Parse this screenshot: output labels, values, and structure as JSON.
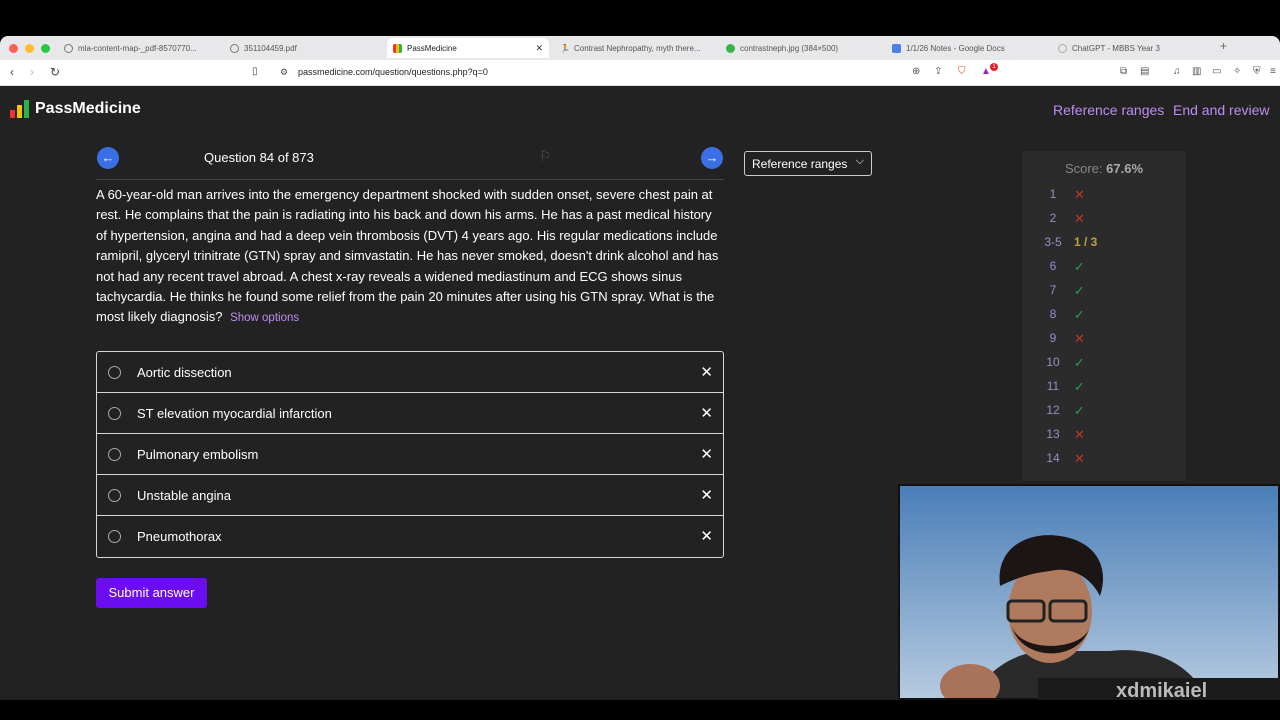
{
  "browser": {
    "tabs": [
      {
        "label": "mla-content-map-_pdf-8570770...",
        "active": false
      },
      {
        "label": "351104459.pdf",
        "active": false
      },
      {
        "label": "PassMedicine",
        "active": true
      },
      {
        "label": "Contrast Nephropathy, myth there...",
        "active": false
      },
      {
        "label": "contrastneph.jpg (384×500)",
        "active": false
      },
      {
        "label": "1/1/26 Notes - Google Docs",
        "active": false
      },
      {
        "label": "ChatGPT - MBBS Year 3",
        "active": false
      }
    ],
    "new_tab": "+",
    "url": "passmedicine.com/question/questions.php?q=0",
    "shield_badge": "1"
  },
  "header": {
    "logo_text": "PassMedicine",
    "reference_ranges": "Reference ranges",
    "end_review": "End and review"
  },
  "question": {
    "counter": "Question 84 of 873",
    "reference_select": "Reference ranges",
    "stem": "A 60-year-old man arrives into the emergency department shocked with sudden onset, severe chest pain at rest. He complains that the pain is radiating into his back and down his arms. He has a past medical history of hypertension, angina and had a deep vein thrombosis (DVT) 4 years ago. His regular medications include ramipril, glyceryl trinitrate (GTN) spray and simvastatin. He has never smoked, doesn't drink alcohol and has not had any recent travel abroad. A chest x-ray reveals a widened mediastinum and ECG shows sinus tachycardia. He thinks he found some relief from the pain 20 minutes after using his GTN spray. What is the most likely diagnosis?",
    "show_options": "Show options",
    "options": [
      "Aortic dissection",
      "ST elevation myocardial infarction",
      "Pulmonary embolism",
      "Unstable angina",
      "Pneumothorax"
    ],
    "option_remove_symbol": "✕",
    "submit_label": "Submit answer"
  },
  "score": {
    "label": "Score:",
    "value": "67.6%",
    "rows": [
      {
        "num": "1",
        "mark": "✕",
        "result": "wrong"
      },
      {
        "num": "2",
        "mark": "✕",
        "result": "wrong"
      },
      {
        "num": "3-5",
        "mark": "1 / 3",
        "result": "partial"
      },
      {
        "num": "6",
        "mark": "✓",
        "result": "correct"
      },
      {
        "num": "7",
        "mark": "✓",
        "result": "correct"
      },
      {
        "num": "8",
        "mark": "✓",
        "result": "correct"
      },
      {
        "num": "9",
        "mark": "✕",
        "result": "wrong"
      },
      {
        "num": "10",
        "mark": "✓",
        "result": "correct"
      },
      {
        "num": "11",
        "mark": "✓",
        "result": "correct"
      },
      {
        "num": "12",
        "mark": "✓",
        "result": "correct"
      },
      {
        "num": "13",
        "mark": "✕",
        "result": "wrong"
      },
      {
        "num": "14",
        "mark": "✕",
        "result": "wrong"
      }
    ]
  },
  "overlay": {
    "watermark": "xdmikaiel"
  },
  "colors": {
    "page_bg": "#222222",
    "link_purple": "#c08cf0",
    "submit_bg": "#6c0cf0",
    "nav_arrow_blue": "#3b6fe6",
    "correct_green": "#2e9e4a",
    "wrong_red": "#c0392b",
    "partial_gold": "#c0a040"
  }
}
